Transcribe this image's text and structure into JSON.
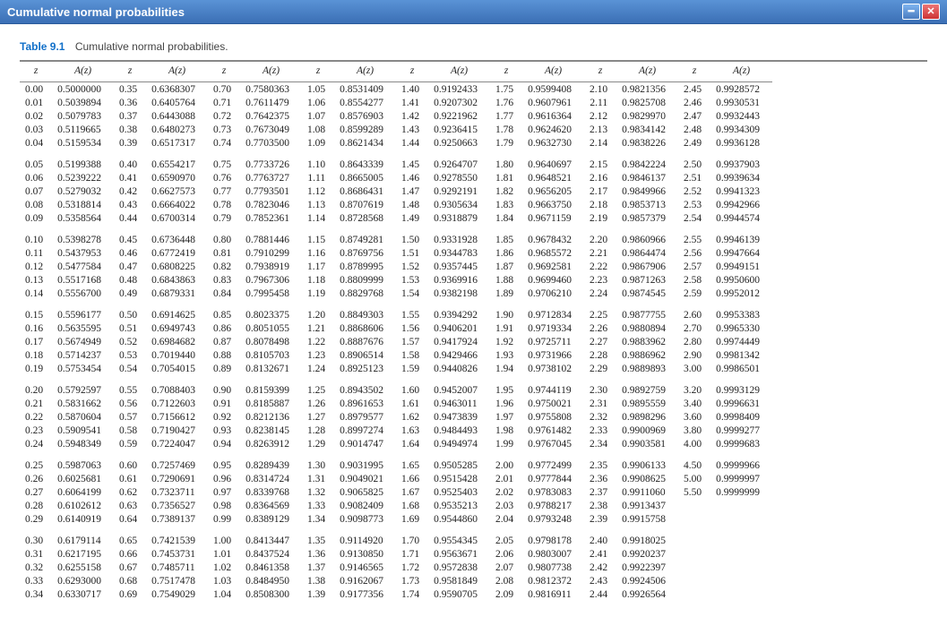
{
  "window": {
    "title": "Cumulative normal probabilities"
  },
  "caption": {
    "label": "Table 9.1",
    "text": "Cumulative normal probabilities."
  },
  "headers": {
    "z": "z",
    "a": "A(z)"
  },
  "chart_data": {
    "type": "table",
    "title": "Cumulative normal probabilities",
    "columns": [
      "z",
      "A(z)"
    ],
    "data": [
      [
        0.0,
        0.5
      ],
      [
        0.01,
        0.5039894
      ],
      [
        0.02,
        0.5079783
      ],
      [
        0.03,
        0.5119665
      ],
      [
        0.04,
        0.5159534
      ],
      [
        0.05,
        0.5199388
      ],
      [
        0.06,
        0.5239222
      ],
      [
        0.07,
        0.5279032
      ],
      [
        0.08,
        0.5318814
      ],
      [
        0.09,
        0.5358564
      ],
      [
        0.1,
        0.5398278
      ],
      [
        0.11,
        0.5437953
      ],
      [
        0.12,
        0.5477584
      ],
      [
        0.13,
        0.5517168
      ],
      [
        0.14,
        0.55567
      ],
      [
        0.15,
        0.5596177
      ],
      [
        0.16,
        0.5635595
      ],
      [
        0.17,
        0.5674949
      ],
      [
        0.18,
        0.5714237
      ],
      [
        0.19,
        0.5753454
      ],
      [
        0.2,
        0.5792597
      ],
      [
        0.21,
        0.5831662
      ],
      [
        0.22,
        0.5870604
      ],
      [
        0.23,
        0.5909541
      ],
      [
        0.24,
        0.5948349
      ],
      [
        0.25,
        0.5987063
      ],
      [
        0.26,
        0.6025681
      ],
      [
        0.27,
        0.6064199
      ],
      [
        0.28,
        0.6102612
      ],
      [
        0.29,
        0.6140919
      ],
      [
        0.3,
        0.6179114
      ],
      [
        0.31,
        0.6217195
      ],
      [
        0.32,
        0.6255158
      ],
      [
        0.33,
        0.6293
      ],
      [
        0.34,
        0.6330717
      ],
      [
        0.35,
        0.6368307
      ],
      [
        0.36,
        0.6405764
      ],
      [
        0.37,
        0.6443088
      ],
      [
        0.38,
        0.6480273
      ],
      [
        0.39,
        0.6517317
      ],
      [
        0.4,
        0.6554217
      ],
      [
        0.41,
        0.659097
      ],
      [
        0.42,
        0.6627573
      ],
      [
        0.43,
        0.6664022
      ],
      [
        0.44,
        0.6700314
      ],
      [
        0.45,
        0.6736448
      ],
      [
        0.46,
        0.6772419
      ],
      [
        0.47,
        0.6808225
      ],
      [
        0.48,
        0.6843863
      ],
      [
        0.49,
        0.6879331
      ],
      [
        0.5,
        0.6914625
      ],
      [
        0.51,
        0.6949743
      ],
      [
        0.52,
        0.6984682
      ],
      [
        0.53,
        0.701944
      ],
      [
        0.54,
        0.7054015
      ],
      [
        0.55,
        0.7088403
      ],
      [
        0.56,
        0.7122603
      ],
      [
        0.57,
        0.7156612
      ],
      [
        0.58,
        0.7190427
      ],
      [
        0.59,
        0.7224047
      ],
      [
        0.6,
        0.7257469
      ],
      [
        0.61,
        0.7290691
      ],
      [
        0.62,
        0.7323711
      ],
      [
        0.63,
        0.7356527
      ],
      [
        0.64,
        0.7389137
      ],
      [
        0.65,
        0.7421539
      ],
      [
        0.66,
        0.7453731
      ],
      [
        0.67,
        0.7485711
      ],
      [
        0.68,
        0.7517478
      ],
      [
        0.69,
        0.7549029
      ],
      [
        0.7,
        0.7580363
      ],
      [
        0.71,
        0.7611479
      ],
      [
        0.72,
        0.7642375
      ],
      [
        0.73,
        0.7673049
      ],
      [
        0.74,
        0.77035
      ],
      [
        0.75,
        0.7733726
      ],
      [
        0.76,
        0.7763727
      ],
      [
        0.77,
        0.7793501
      ],
      [
        0.78,
        0.7823046
      ],
      [
        0.79,
        0.7852361
      ],
      [
        0.8,
        0.7881446
      ],
      [
        0.81,
        0.7910299
      ],
      [
        0.82,
        0.7938919
      ],
      [
        0.83,
        0.7967306
      ],
      [
        0.84,
        0.7995458
      ],
      [
        0.85,
        0.8023375
      ],
      [
        0.86,
        0.8051055
      ],
      [
        0.87,
        0.8078498
      ],
      [
        0.88,
        0.8105703
      ],
      [
        0.89,
        0.8132671
      ],
      [
        0.9,
        0.8159399
      ],
      [
        0.91,
        0.8185887
      ],
      [
        0.92,
        0.8212136
      ],
      [
        0.93,
        0.8238145
      ],
      [
        0.94,
        0.8263912
      ],
      [
        0.95,
        0.8289439
      ],
      [
        0.96,
        0.8314724
      ],
      [
        0.97,
        0.8339768
      ],
      [
        0.98,
        0.8364569
      ],
      [
        0.99,
        0.8389129
      ],
      [
        1.0,
        0.8413447
      ],
      [
        1.01,
        0.8437524
      ],
      [
        1.02,
        0.8461358
      ],
      [
        1.03,
        0.848495
      ],
      [
        1.04,
        0.85083
      ],
      [
        1.05,
        0.8531409
      ],
      [
        1.06,
        0.8554277
      ],
      [
        1.07,
        0.8576903
      ],
      [
        1.08,
        0.8599289
      ],
      [
        1.09,
        0.8621434
      ],
      [
        1.1,
        0.8643339
      ],
      [
        1.11,
        0.8665005
      ],
      [
        1.12,
        0.8686431
      ],
      [
        1.13,
        0.8707619
      ],
      [
        1.14,
        0.8728568
      ],
      [
        1.15,
        0.8749281
      ],
      [
        1.16,
        0.8769756
      ],
      [
        1.17,
        0.8789995
      ],
      [
        1.18,
        0.8809999
      ],
      [
        1.19,
        0.8829768
      ],
      [
        1.2,
        0.8849303
      ],
      [
        1.21,
        0.8868606
      ],
      [
        1.22,
        0.8887676
      ],
      [
        1.23,
        0.8906514
      ],
      [
        1.24,
        0.8925123
      ],
      [
        1.25,
        0.8943502
      ],
      [
        1.26,
        0.8961653
      ],
      [
        1.27,
        0.8979577
      ],
      [
        1.28,
        0.8997274
      ],
      [
        1.29,
        0.9014747
      ],
      [
        1.3,
        0.9031995
      ],
      [
        1.31,
        0.9049021
      ],
      [
        1.32,
        0.9065825
      ],
      [
        1.33,
        0.9082409
      ],
      [
        1.34,
        0.9098773
      ],
      [
        1.35,
        0.911492
      ],
      [
        1.36,
        0.913085
      ],
      [
        1.37,
        0.9146565
      ],
      [
        1.38,
        0.9162067
      ],
      [
        1.39,
        0.9177356
      ],
      [
        1.4,
        0.9192433
      ],
      [
        1.41,
        0.9207302
      ],
      [
        1.42,
        0.9221962
      ],
      [
        1.43,
        0.9236415
      ],
      [
        1.44,
        0.9250663
      ],
      [
        1.45,
        0.9264707
      ],
      [
        1.46,
        0.927855
      ],
      [
        1.47,
        0.9292191
      ],
      [
        1.48,
        0.9305634
      ],
      [
        1.49,
        0.9318879
      ],
      [
        1.5,
        0.9331928
      ],
      [
        1.51,
        0.9344783
      ],
      [
        1.52,
        0.9357445
      ],
      [
        1.53,
        0.9369916
      ],
      [
        1.54,
        0.9382198
      ],
      [
        1.55,
        0.9394292
      ],
      [
        1.56,
        0.9406201
      ],
      [
        1.57,
        0.9417924
      ],
      [
        1.58,
        0.9429466
      ],
      [
        1.59,
        0.9440826
      ],
      [
        1.6,
        0.9452007
      ],
      [
        1.61,
        0.9463011
      ],
      [
        1.62,
        0.9473839
      ],
      [
        1.63,
        0.9484493
      ],
      [
        1.64,
        0.9494974
      ],
      [
        1.65,
        0.9505285
      ],
      [
        1.66,
        0.9515428
      ],
      [
        1.67,
        0.9525403
      ],
      [
        1.68,
        0.9535213
      ],
      [
        1.69,
        0.954486
      ],
      [
        1.7,
        0.9554345
      ],
      [
        1.71,
        0.9563671
      ],
      [
        1.72,
        0.9572838
      ],
      [
        1.73,
        0.9581849
      ],
      [
        1.74,
        0.9590705
      ],
      [
        1.75,
        0.9599408
      ],
      [
        1.76,
        0.9607961
      ],
      [
        1.77,
        0.9616364
      ],
      [
        1.78,
        0.962462
      ],
      [
        1.79,
        0.963273
      ],
      [
        1.8,
        0.9640697
      ],
      [
        1.81,
        0.9648521
      ],
      [
        1.82,
        0.9656205
      ],
      [
        1.83,
        0.966375
      ],
      [
        1.84,
        0.9671159
      ],
      [
        1.85,
        0.9678432
      ],
      [
        1.86,
        0.9685572
      ],
      [
        1.87,
        0.9692581
      ],
      [
        1.88,
        0.969946
      ],
      [
        1.89,
        0.970621
      ],
      [
        1.9,
        0.9712834
      ],
      [
        1.91,
        0.9719334
      ],
      [
        1.92,
        0.9725711
      ],
      [
        1.93,
        0.9731966
      ],
      [
        1.94,
        0.9738102
      ],
      [
        1.95,
        0.9744119
      ],
      [
        1.96,
        0.9750021
      ],
      [
        1.97,
        0.9755808
      ],
      [
        1.98,
        0.9761482
      ],
      [
        1.99,
        0.9767045
      ],
      [
        2.0,
        0.9772499
      ],
      [
        2.01,
        0.9777844
      ],
      [
        2.02,
        0.9783083
      ],
      [
        2.03,
        0.9788217
      ],
      [
        2.04,
        0.9793248
      ],
      [
        2.05,
        0.9798178
      ],
      [
        2.06,
        0.9803007
      ],
      [
        2.07,
        0.9807738
      ],
      [
        2.08,
        0.9812372
      ],
      [
        2.09,
        0.9816911
      ],
      [
        2.1,
        0.9821356
      ],
      [
        2.11,
        0.9825708
      ],
      [
        2.12,
        0.982997
      ],
      [
        2.13,
        0.9834142
      ],
      [
        2.14,
        0.9838226
      ],
      [
        2.15,
        0.9842224
      ],
      [
        2.16,
        0.9846137
      ],
      [
        2.17,
        0.9849966
      ],
      [
        2.18,
        0.9853713
      ],
      [
        2.19,
        0.9857379
      ],
      [
        2.2,
        0.9860966
      ],
      [
        2.21,
        0.9864474
      ],
      [
        2.22,
        0.9867906
      ],
      [
        2.23,
        0.9871263
      ],
      [
        2.24,
        0.9874545
      ],
      [
        2.25,
        0.9877755
      ],
      [
        2.26,
        0.9880894
      ],
      [
        2.27,
        0.9883962
      ],
      [
        2.28,
        0.9886962
      ],
      [
        2.29,
        0.9889893
      ],
      [
        2.3,
        0.9892759
      ],
      [
        2.31,
        0.9895559
      ],
      [
        2.32,
        0.9898296
      ],
      [
        2.33,
        0.9900969
      ],
      [
        2.34,
        0.9903581
      ],
      [
        2.35,
        0.9906133
      ],
      [
        2.36,
        0.9908625
      ],
      [
        2.37,
        0.991106
      ],
      [
        2.38,
        0.9913437
      ],
      [
        2.39,
        0.9915758
      ],
      [
        2.4,
        0.9918025
      ],
      [
        2.41,
        0.9920237
      ],
      [
        2.42,
        0.9922397
      ],
      [
        2.43,
        0.9924506
      ],
      [
        2.44,
        0.9926564
      ],
      [
        2.45,
        0.9928572
      ],
      [
        2.46,
        0.9930531
      ],
      [
        2.47,
        0.9932443
      ],
      [
        2.48,
        0.9934309
      ],
      [
        2.49,
        0.9936128
      ],
      [
        2.5,
        0.9937903
      ],
      [
        2.51,
        0.9939634
      ],
      [
        2.52,
        0.9941323
      ],
      [
        2.53,
        0.9942966
      ],
      [
        2.54,
        0.9944574
      ],
      [
        2.55,
        0.9946139
      ],
      [
        2.56,
        0.9947664
      ],
      [
        2.57,
        0.9949151
      ],
      [
        2.58,
        0.99506
      ],
      [
        2.59,
        0.9952012
      ],
      [
        2.6,
        0.9953383
      ],
      [
        2.7,
        0.996533
      ],
      [
        2.8,
        0.9974449
      ],
      [
        2.9,
        0.9981342
      ],
      [
        3.0,
        0.9986501
      ],
      [
        3.2,
        0.9993129
      ],
      [
        3.4,
        0.9996631
      ],
      [
        3.6,
        0.9998409
      ],
      [
        3.8,
        0.9999277
      ],
      [
        4.0,
        0.9999683
      ],
      [
        4.5,
        0.9999966
      ],
      [
        5.0,
        0.9999997
      ],
      [
        5.5,
        0.9999999
      ]
    ]
  },
  "column_layout": {
    "columns": 8,
    "rows_per_column": 35,
    "last_column_rows": 28
  }
}
